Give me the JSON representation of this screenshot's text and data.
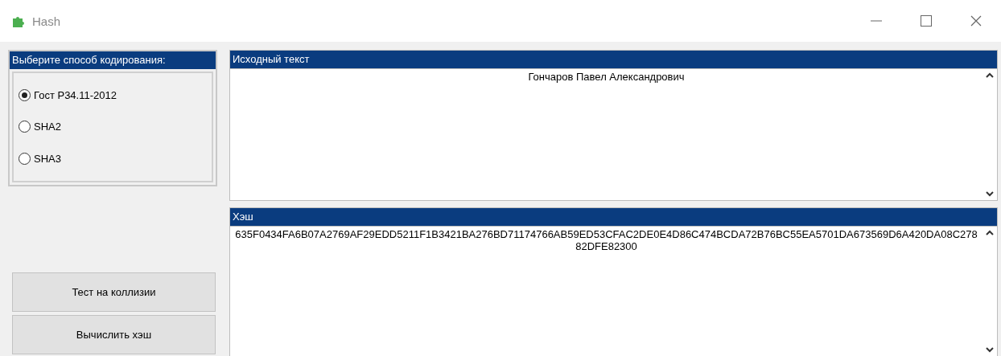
{
  "window": {
    "title": "Hash"
  },
  "encoding_group": {
    "title": "Выберите способ кодирования:",
    "options": [
      {
        "label": "Гост Р34.11-2012",
        "selected": true
      },
      {
        "label": "SHA2",
        "selected": false
      },
      {
        "label": "SHA3",
        "selected": false
      }
    ]
  },
  "buttons": [
    "Тест на коллизии",
    "Вычислить хэш"
  ],
  "source_panel": {
    "title": "Исходный текст",
    "value": "Гончаров Павел Александрович"
  },
  "hash_panel": {
    "title": "Хэш",
    "value": "635F0434FA6B07A2769AF29EDD5211F1B3421BA276BD71174766AB59ED53CFAC2DE0E4D86C474BCDA72B76BC55EA5701DA673569D6A420DA08C27882DFE82300"
  }
}
